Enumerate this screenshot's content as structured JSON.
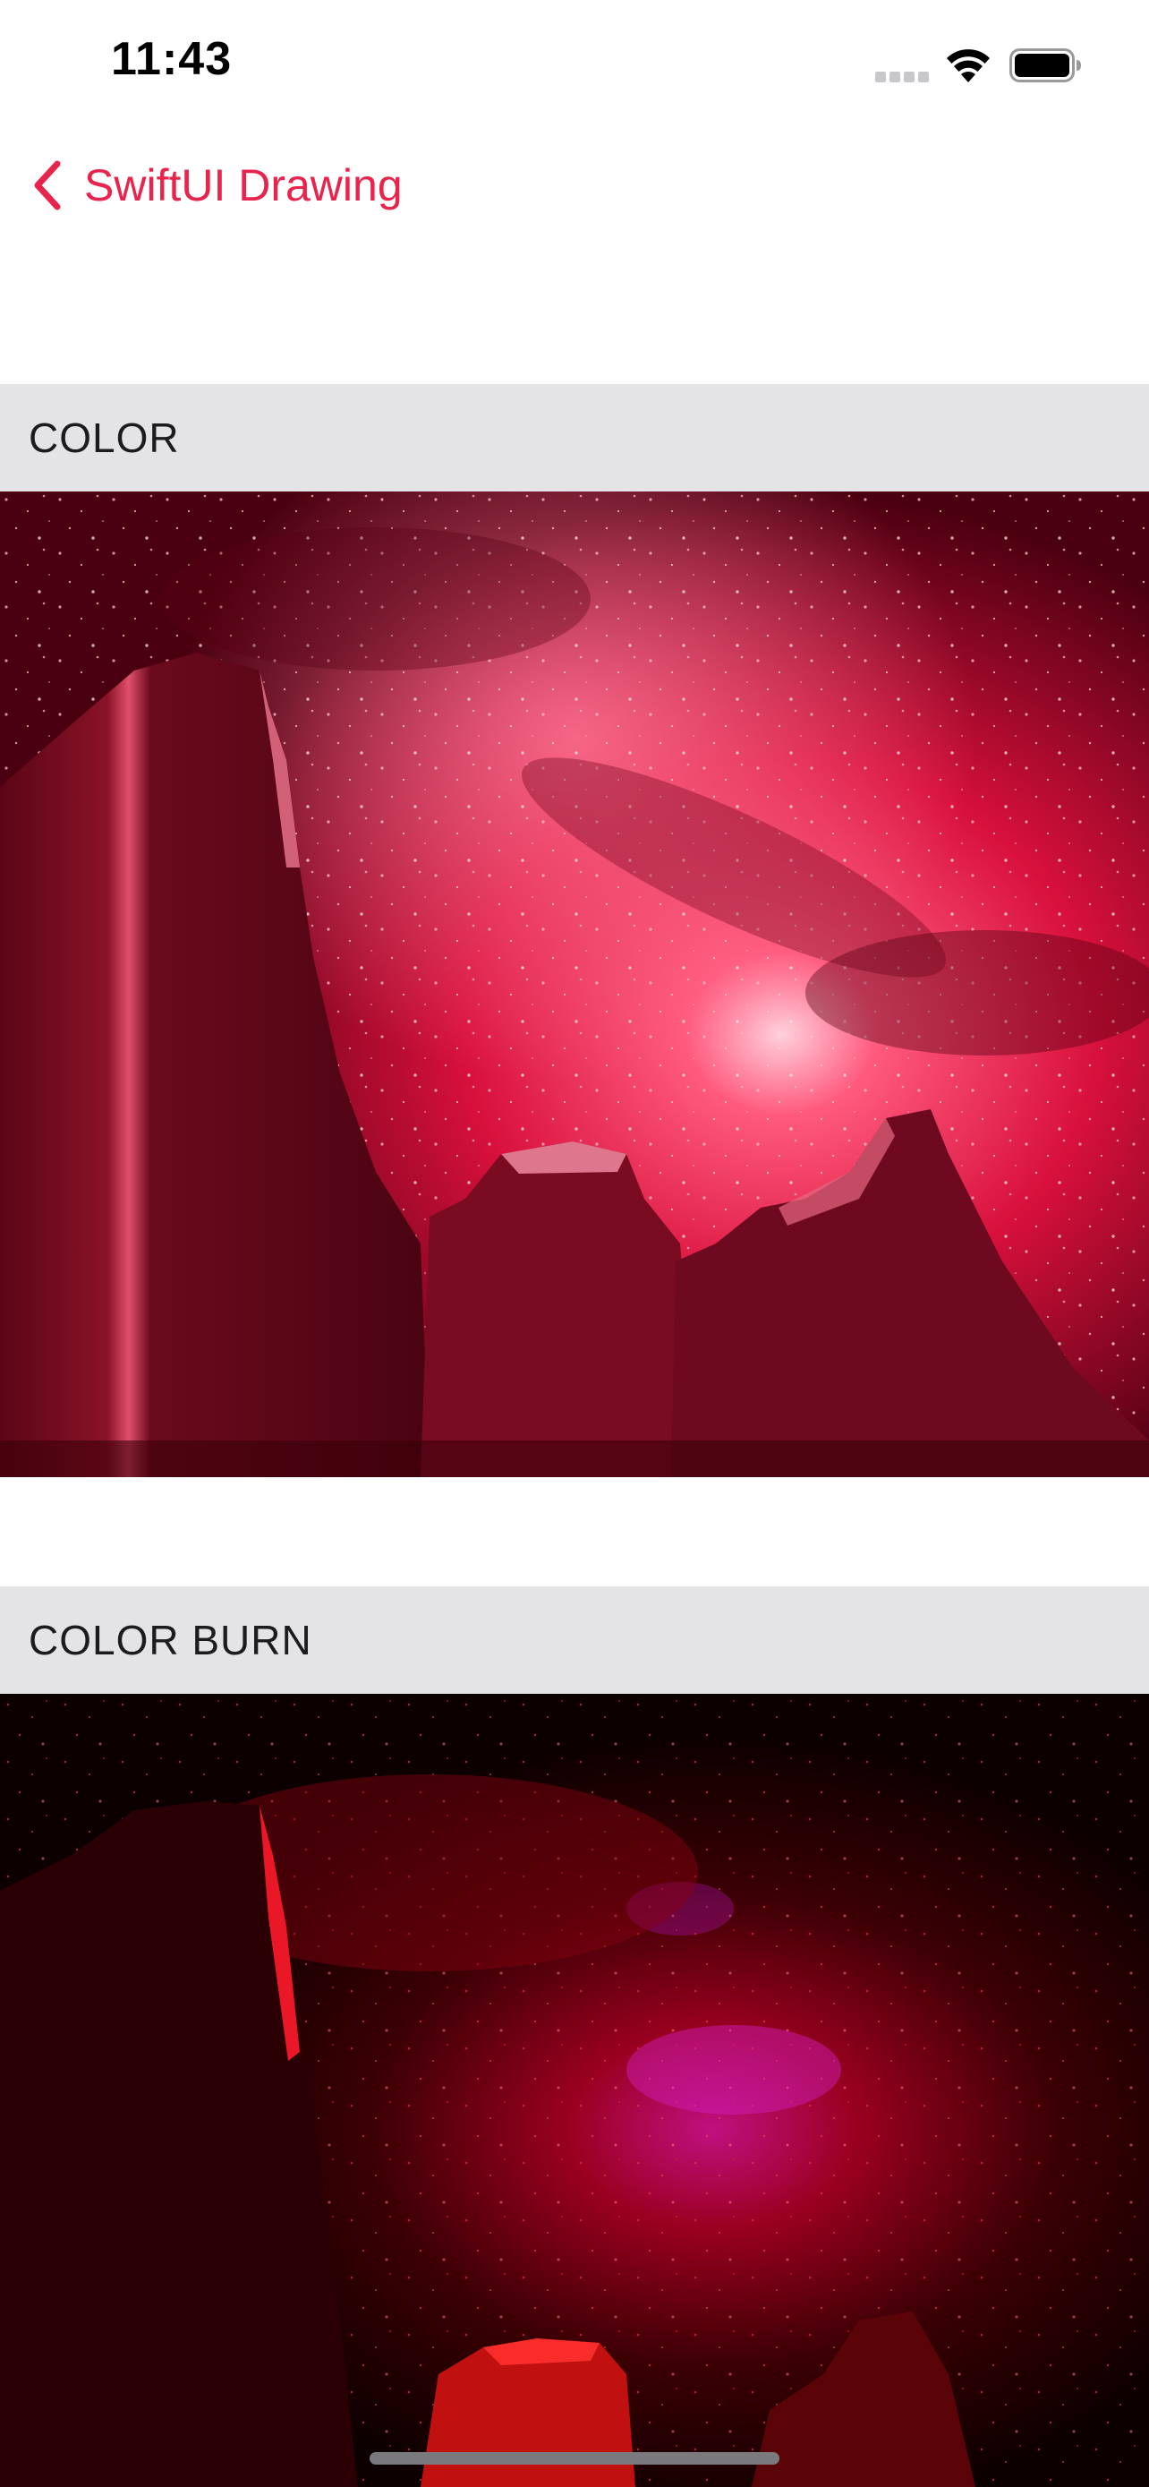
{
  "status_bar": {
    "time": "11:43",
    "icons": [
      "cellular-signal-icon",
      "wifi-icon",
      "battery-icon"
    ]
  },
  "nav": {
    "back_label": "SwiftUI Drawing",
    "back_icon": "chevron-left-icon",
    "accent_color": "#e8244d"
  },
  "sections": [
    {
      "header": "COLOR",
      "image": "night-sky-rock-formations-photo",
      "tint": "#e0143c"
    },
    {
      "header": "COLOR BURN",
      "image": "night-sky-rock-formations-photo",
      "tint": "#b00018"
    }
  ]
}
